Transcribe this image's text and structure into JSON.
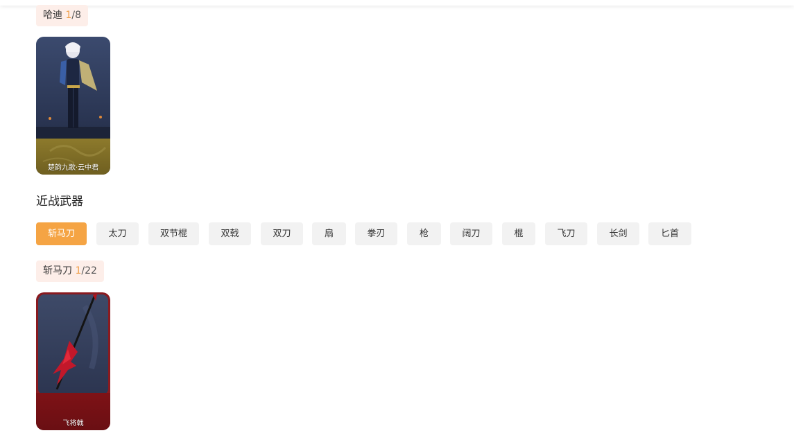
{
  "skin_group": {
    "name": "哈迪",
    "owned": "1",
    "total": "8",
    "items": [
      {
        "label": "楚韵九歌·云中君"
      }
    ]
  },
  "melee_section": {
    "title": "近战武器",
    "tabs": [
      {
        "label": "斩马刀",
        "active": true
      },
      {
        "label": "太刀"
      },
      {
        "label": "双节棍"
      },
      {
        "label": "双戟"
      },
      {
        "label": "双刀"
      },
      {
        "label": "扇"
      },
      {
        "label": "拳刃"
      },
      {
        "label": "枪"
      },
      {
        "label": "阔刀"
      },
      {
        "label": "棍"
      },
      {
        "label": "飞刀"
      },
      {
        "label": "长剑"
      },
      {
        "label": "匕首"
      }
    ],
    "active_group": {
      "name": "斩马刀",
      "owned": "1",
      "total": "22",
      "items": [
        {
          "label": "飞将戟"
        }
      ]
    }
  },
  "colors": {
    "accent": "#f5a444",
    "badge_bg": "#fdeee9",
    "count_highlight": "#f0a04a",
    "tab_bg": "#f2f2f2",
    "gold_card_bg": "#8a7a2e",
    "red_card_bg": "#7a1418"
  }
}
